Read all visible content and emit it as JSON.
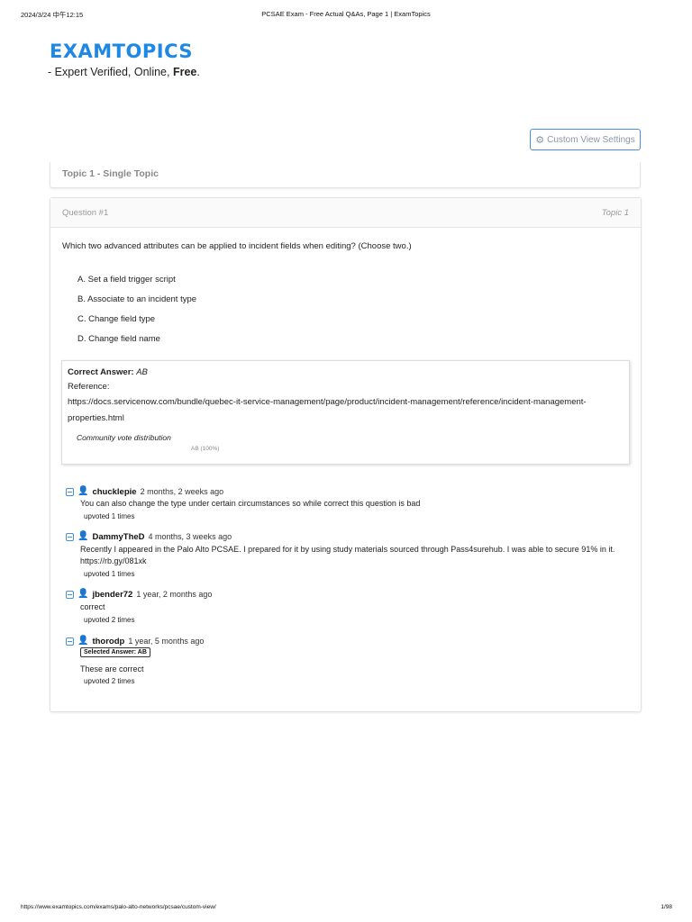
{
  "print_header": {
    "date": "2024/3/24 中午12:15",
    "title": "PCSAE Exam - Free Actual Q&As, Page 1 | ExamTopics"
  },
  "print_footer": {
    "url": "https://www.examtopics.com/exams/palo-alto-networks/pcsae/custom-view/",
    "page": "1/98"
  },
  "brand": {
    "logo_text": "EXAMTOPICS",
    "tagline_prefix": "- Expert Verified, Online, ",
    "tagline_bold": "Free",
    "tagline_suffix": "."
  },
  "custom_view": {
    "icon": "gear-icon",
    "label": "Custom View Settings"
  },
  "topic_card": {
    "title": "Topic 1 - Single Topic"
  },
  "question": {
    "number": "Question #1",
    "topic": "Topic 1",
    "text": "Which two advanced attributes can be applied to incident fields when editing? (Choose two.)",
    "choices": [
      "A. Set a field trigger script",
      "B. Associate to an incident type",
      "C. Change field type",
      "D. Change field name"
    ]
  },
  "answer": {
    "label": "Correct Answer:",
    "value": "AB",
    "reference_label": "Reference:",
    "reference_url_line1": "https://docs.servicenow.com/bundle/quebec-it-service-management/page/product/incident-management/reference/incident-management-",
    "reference_url_line2": "properties.html",
    "vote_title": "Community vote distribution",
    "vote_bar_label": "AB (100%)",
    "vote_fraction": 1.0
  },
  "comments": [
    {
      "user": "chucklepie",
      "time": "2 months, 2 weeks ago",
      "body": [
        "You can also change the type under certain circumstances so while correct this question is bad"
      ],
      "upvotes": "upvoted 1 times"
    },
    {
      "user": "DammyTheD",
      "time": "4 months, 3 weeks ago",
      "body": [
        "Recently I appeared in the Palo Alto PCSAE. I prepared for it by using study materials sourced through Pass4surehub. I was able to secure 91% in it.",
        "https://rb.gy/081xk"
      ],
      "upvotes": "upvoted 1 times"
    },
    {
      "user": "jbender72",
      "time": "1 year, 2 months ago",
      "body": [
        "correct"
      ],
      "upvotes": "upvoted 2 times"
    },
    {
      "user": "thorodp",
      "time": "1 year, 5 months ago",
      "selected_answer": "Selected Answer: AB",
      "body": [
        "These are correct"
      ],
      "upvotes": "upvoted 2 times"
    }
  ],
  "colors": {
    "accent": "#1e88e5",
    "button_border": "#4a90d9"
  }
}
